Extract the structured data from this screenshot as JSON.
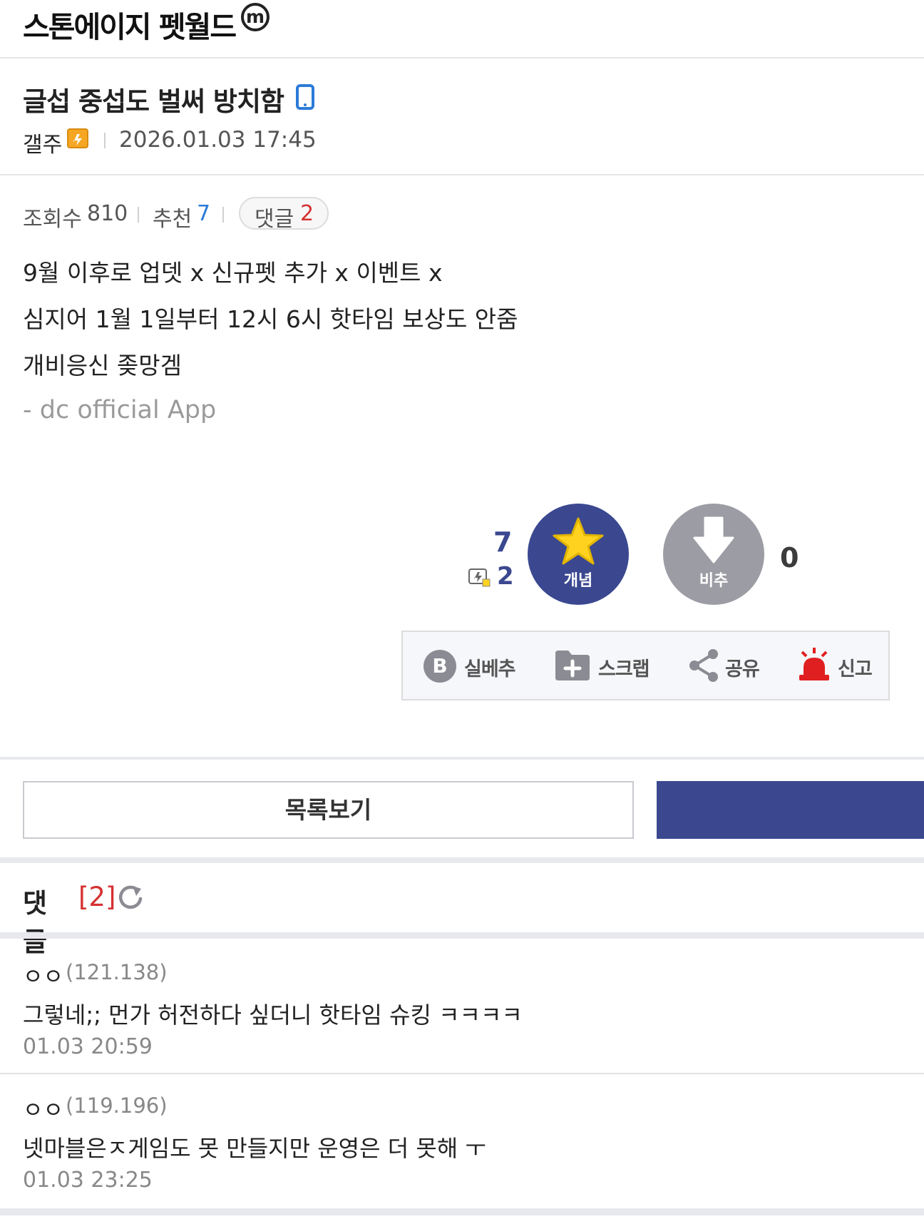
{
  "header": {
    "gallery_title": "스톤에이지 펫월드",
    "minor_badge": "m"
  },
  "post": {
    "title": "글섭 중섭도 벌써 방치함",
    "author": "갤주",
    "date": "2026.01.03 17:45",
    "stats": {
      "views_label": "조회수",
      "views": "810",
      "recommend_label": "추천",
      "recommend": "7",
      "comments_label": "댓글",
      "comments": "2"
    },
    "body": [
      "9월 이후로 업뎃 x 신규펫 추가 x 이벤트 x",
      "심지어 1월 1일부터 12시 6시 핫타임 보상도 안줌",
      "개비응신 좆망겜"
    ],
    "app_signature": "- dc official App"
  },
  "votes": {
    "up_count": "7",
    "fixed_up_count": "2",
    "up_label": "개념",
    "down_label": "비추",
    "down_count": "0"
  },
  "actions": [
    {
      "label": "실베추",
      "icon": "b-circle-icon"
    },
    {
      "label": "스크랩",
      "icon": "folder-plus-icon"
    },
    {
      "label": "공유",
      "icon": "share-icon"
    },
    {
      "label": "신고",
      "icon": "siren-icon"
    }
  ],
  "buttons": {
    "list_label": "목록보기"
  },
  "comments_section": {
    "title": "댓글",
    "count": "[2]",
    "items": [
      {
        "nick": "ㅇㅇ",
        "ip": "(121.138)",
        "text": "그렇네;; 먼가 허전하다 싶더니 핫타임 슈킹 ㅋㅋㅋㅋ",
        "time": "01.03 20:59"
      },
      {
        "nick": "ㅇㅇ",
        "ip": "(119.196)",
        "text": "넷마블은ㅈ게임도 못 만들지만 운영은 더 못해 ㅜ",
        "time": "01.03 23:25"
      }
    ]
  },
  "colors": {
    "accent": "#3b4890",
    "down": "#9c9ca4",
    "red": "#d53131",
    "blue": "#2b7bd8",
    "star": "#ffd21f"
  }
}
